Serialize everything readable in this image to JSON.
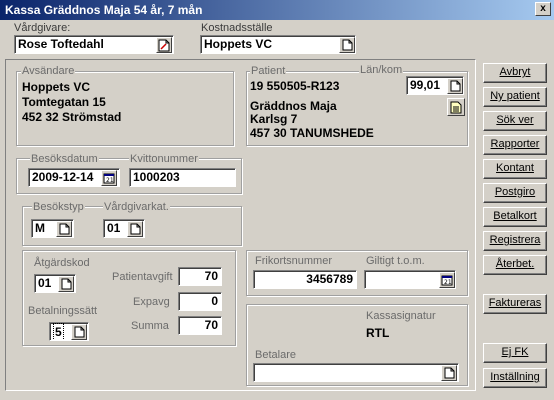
{
  "window": {
    "title": "Kassa Gräddnos Maja 54 år, 7 mån",
    "close_label": "x"
  },
  "top": {
    "vardgivare_label": "Vårdgivare:",
    "vardgivare_value": "Rose Toftedahl",
    "kostnadsstalle_label": "Kostnadsställe",
    "kostnadsstalle_value": "Hoppets VC"
  },
  "avsandare": {
    "label": "Avsändare",
    "line1": "Hoppets VC",
    "line2": "Tomtegatan 15",
    "line3": "452 32 Strömstad"
  },
  "patient": {
    "label": "Patient",
    "id": "19 550505-R123",
    "lan_kom_label": "Län/kom",
    "lan_kom_value": "99,01",
    "name": "Gräddnos Maja",
    "street": "Karlsg 7",
    "city": "457 30  TANUMSHEDE"
  },
  "visit": {
    "besoksdatum_label": "Besöksdatum",
    "besoksdatum_value": "2009-12-14",
    "kvittonummer_label": "Kvittonummer",
    "kvittonummer_value": "1000203",
    "besokstyp_label": "Besökstyp",
    "besokstyp_value": "M",
    "vardgivarkat_label": "Vårdgivarkat.",
    "vardgivarkat_value": "01"
  },
  "payment": {
    "atgardskod_label": "Åtgärdskod",
    "atgardskod_value": "01",
    "betalningssatt_label": "Betalningssätt",
    "betalningssatt_value": "5",
    "patientavgift_label": "Patientavgift",
    "patientavgift_value": "70",
    "expavg_label": "Expavg",
    "expavg_value": "0",
    "summa_label": "Summa",
    "summa_value": "70"
  },
  "frikort": {
    "nummer_label": "Frikortsnummer",
    "nummer_value": "3456789",
    "giltigt_label": "Giltigt t.o.m.",
    "giltigt_value": ""
  },
  "kassa": {
    "signatur_label": "Kassasignatur",
    "signatur_value": "RTL",
    "betalare_label": "Betalare",
    "betalare_value": ""
  },
  "sidebar": {
    "avbryt": "Avbryt",
    "ny_patient": "Ny patient",
    "sok_ver": "Sök ver",
    "rapporter": "Rapporter",
    "kontant": "Kontant",
    "postgiro": "Postgiro",
    "betalkort": "Betalkort",
    "registrera": "Registrera",
    "aterbet": "Återbet.",
    "faktureras": "Faktureras",
    "ej_fk": "Ej FK",
    "installning": "Inställning"
  },
  "icons": {
    "doc": "document-icon",
    "calendar": "calendar-icon",
    "edit": "edit-document-icon",
    "notes": "notes-icon"
  }
}
